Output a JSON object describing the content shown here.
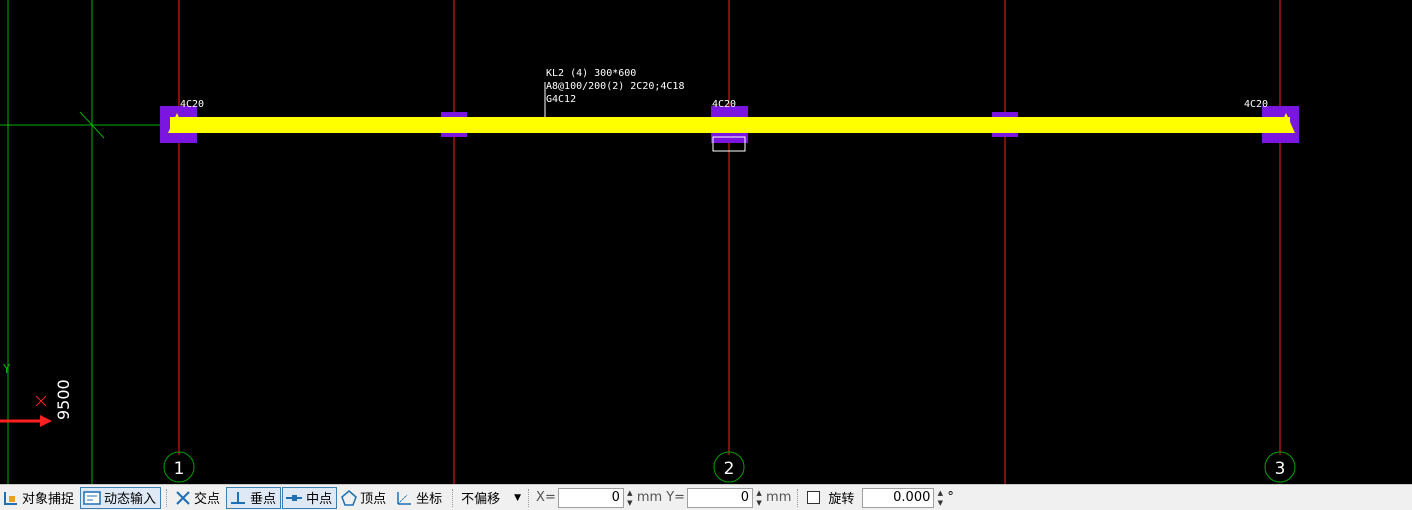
{
  "drawing": {
    "beam": {
      "label_line1": "KL2 (4)  300*600",
      "label_line2": "A8@100/200(2) 2C20;4C18",
      "label_line3": "G4C12",
      "top_rebar_labels": [
        "4C20",
        "4C20",
        "4C20"
      ]
    },
    "axes": [
      {
        "label": "1"
      },
      {
        "label": "2"
      },
      {
        "label": "3"
      }
    ],
    "ucs": {
      "y_label": "Y",
      "dimension": "9500"
    },
    "colors": {
      "background": "#000000",
      "beam": "#ffff00",
      "column": "#7b16e0",
      "axis_line": "#ff2020",
      "axis_bubble": "#00a000",
      "grid": "#00b000"
    }
  },
  "statusbar": {
    "snap_label": "对象捕捉",
    "dynamic_input_label": "动态输入",
    "intersection_label": "交点",
    "perpendicular_label": "垂点",
    "midpoint_label": "中点",
    "vertex_label": "顶点",
    "coordinate_label": "坐标",
    "offset_value": "不偏移",
    "x_label": "X=",
    "x_value": "0",
    "y_label": "Y=",
    "y_value": "0",
    "unit_mm": "mm",
    "rotate_label": "旋转",
    "rotate_value": "0.000",
    "degree_symbol": "°"
  }
}
